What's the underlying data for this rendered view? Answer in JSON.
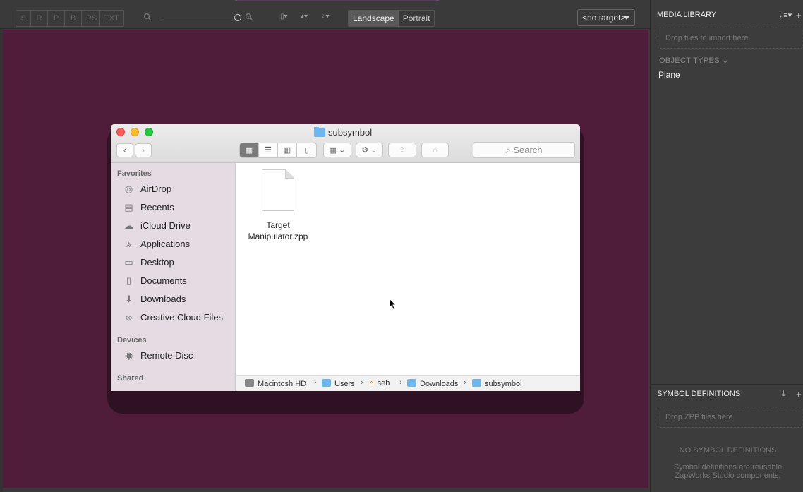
{
  "toolbar": {
    "modes": [
      "S",
      "R",
      "P",
      "B",
      "RS",
      "TXT"
    ],
    "orientation": {
      "landscape": "Landscape",
      "portrait": "Portrait",
      "active": "Landscape"
    },
    "target": "<no target>"
  },
  "right_panel": {
    "media_library": {
      "title": "MEDIA LIBRARY",
      "drop_hint": "Drop files to import here",
      "object_types_label": "OBJECT TYPES",
      "object_types": [
        "Plane"
      ]
    },
    "symbol_definitions": {
      "title": "SYMBOL DEFINITIONS",
      "drop_hint": "Drop ZPP files here",
      "empty_title": "NO SYMBOL DEFINITIONS",
      "empty_desc_1": "Symbol definitions are reusable",
      "empty_desc_2": "ZapWorks Studio components."
    }
  },
  "finder": {
    "title": "subsymbol",
    "search_placeholder": "Search",
    "sidebar": {
      "favorites_label": "Favorites",
      "favorites": [
        {
          "label": "AirDrop",
          "icon": "airdrop-icon"
        },
        {
          "label": "Recents",
          "icon": "recents-icon"
        },
        {
          "label": "iCloud Drive",
          "icon": "cloud-icon"
        },
        {
          "label": "Applications",
          "icon": "applications-icon"
        },
        {
          "label": "Desktop",
          "icon": "desktop-icon"
        },
        {
          "label": "Documents",
          "icon": "documents-icon"
        },
        {
          "label": "Downloads",
          "icon": "downloads-icon"
        },
        {
          "label": "Creative Cloud Files",
          "icon": "creative-cloud-icon"
        }
      ],
      "devices_label": "Devices",
      "devices": [
        {
          "label": "Remote Disc",
          "icon": "disc-icon"
        }
      ],
      "shared_label": "Shared"
    },
    "files": [
      {
        "name_line1": "Target",
        "name_line2": "Manipulator.zpp"
      }
    ],
    "path": [
      "Macintosh HD",
      "Users",
      "seb",
      "Downloads",
      "subsymbol"
    ]
  },
  "colors": {
    "canvas": "#4f1c3a",
    "panel": "#3c3c3c",
    "folder_blue": "#6cb7f0"
  }
}
